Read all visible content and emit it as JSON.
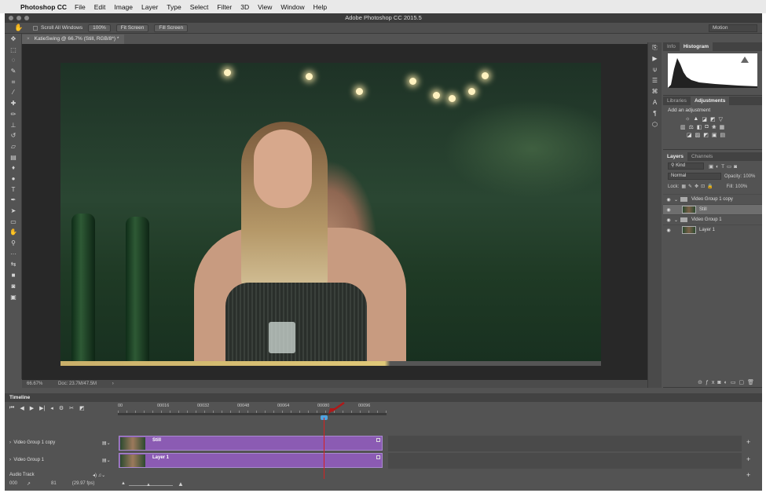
{
  "menubar": {
    "app_name": "Photoshop CC",
    "items": [
      "File",
      "Edit",
      "Image",
      "Layer",
      "Type",
      "Select",
      "Filter",
      "3D",
      "View",
      "Window",
      "Help"
    ]
  },
  "window": {
    "title": "Adobe Photoshop CC 2015.5"
  },
  "options": {
    "scroll_all": "Scroll All Windows",
    "zoom_100": "100%",
    "fit_screen": "Fit Screen",
    "fill_screen": "Fill Screen",
    "workspace": "Motion"
  },
  "document": {
    "tab_title": "KatieSwing @ 66.7% (Still, RGB/8*) *",
    "zoom": "66.67%",
    "doc_size": "Doc: 23.7M/47.5M"
  },
  "panels": {
    "info_tab": "Info",
    "histogram_tab": "Histogram",
    "libraries_tab": "Libraries",
    "adjustments_tab": "Adjustments",
    "add_adjustment": "Add an adjustment",
    "layers_tab": "Layers",
    "channels_tab": "Channels",
    "filter_kind": "Kind",
    "blend_mode": "Normal",
    "opacity_label": "Opacity:",
    "opacity_value": "100%",
    "lock_label": "Lock:",
    "fill_label": "Fill:",
    "fill_value": "100%"
  },
  "layers": [
    {
      "name": "Video Group 1 copy",
      "type": "group"
    },
    {
      "name": "Still",
      "type": "layer",
      "selected": true
    },
    {
      "name": "Video Group 1",
      "type": "group"
    },
    {
      "name": "Layer 1",
      "type": "layer"
    }
  ],
  "timeline": {
    "title": "Timeline",
    "ruler": [
      "00",
      "00016",
      "00032",
      "00048",
      "00064",
      "00080",
      "00096"
    ],
    "tracks": [
      {
        "label": "Video Group 1 copy",
        "clip": "Still"
      },
      {
        "label": "Video Group 1",
        "clip": "Layer 1"
      }
    ],
    "audio_track": "Audio Track",
    "current_time": "000",
    "frame": "81",
    "fps": "(29.97 fps)"
  },
  "colors": {
    "clip": "#8b5bb3",
    "playhead": "#d62020",
    "annotation_arrow": "#b01818"
  }
}
